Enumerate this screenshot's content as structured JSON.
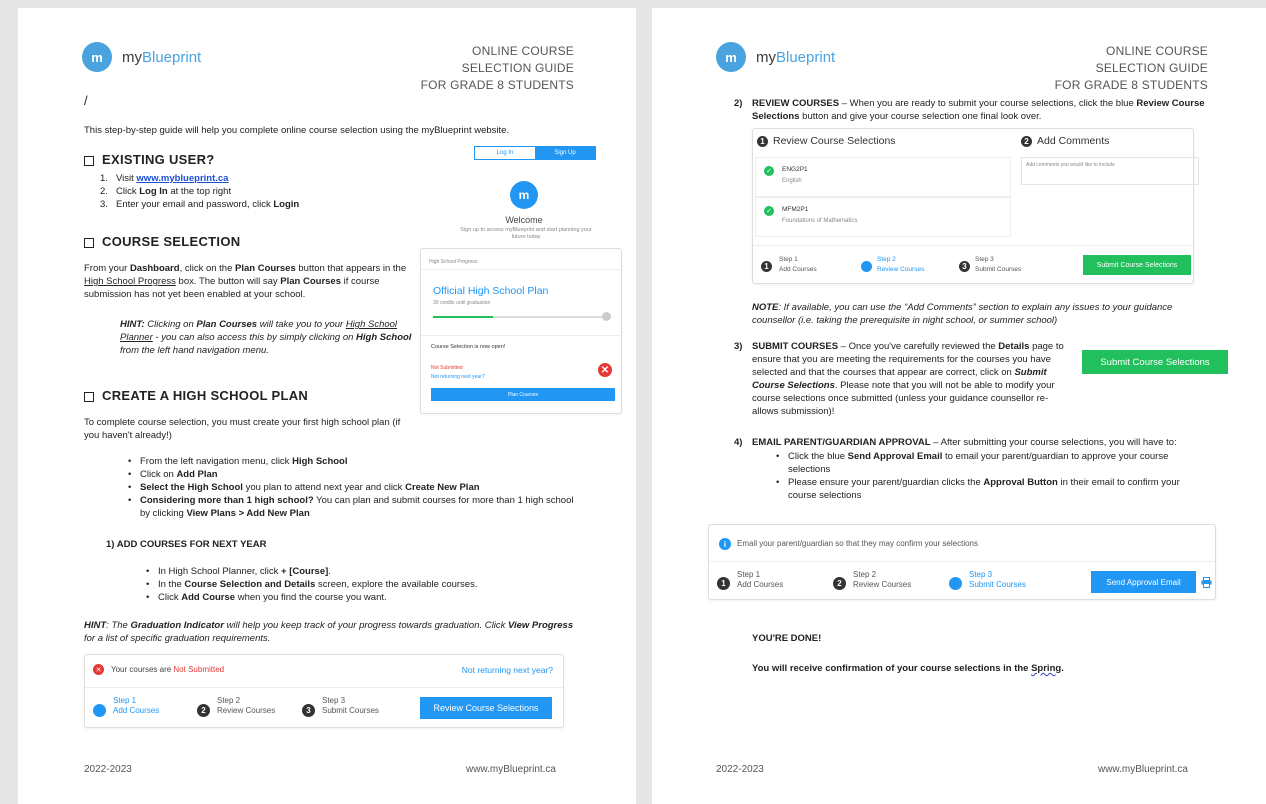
{
  "brand": {
    "logo_glyph": "m",
    "name_prefix": "my",
    "name_suffix": "Blueprint",
    "accent": "#4aa3df"
  },
  "guide_title": [
    "ONLINE COURSE",
    "SELECTION GUIDE",
    "FOR GRADE 8 STUDENTS"
  ],
  "page1": {
    "slash": "/",
    "intro": "This step-by-step guide will help you complete online course selection using the myBlueprint website.",
    "existing_user": {
      "heading": "EXISTING USER?",
      "items": [
        {
          "num": "1.",
          "pre": "Visit ",
          "bold": "www.myblueprint.ca",
          "post": ""
        },
        {
          "num": "2.",
          "pre": "Click ",
          "bold": "Log In",
          "post": " at the top right"
        },
        {
          "num": "3.",
          "pre": "Enter your email and password, click ",
          "bold": "Login",
          "post": ""
        }
      ]
    },
    "login_mock": {
      "tab_login": "Log In",
      "tab_signup": "Sign Up",
      "welcome": "Welcome",
      "subtext": "Sign up to access myBlueprint and start planning your future today"
    },
    "course_selection": {
      "heading": "COURSE SELECTION",
      "p1_a": "From your ",
      "p1_b": "Dashboard",
      "p1_c": ", click on the ",
      "p1_d": "Plan Courses",
      "p1_e": " button that appears in the ",
      "p1_f": "High School Progress",
      "p1_g": " box.  The button will say ",
      "p1_h": "Plan Courses",
      "p1_i": " if course submission has not yet been enabled at your school.",
      "hint_label": "HINT:",
      "hint_a": " Clicking on ",
      "hint_b": "Plan Courses",
      "hint_c": " will take you to your ",
      "hint_d": "High School Planner",
      "hint_e": " - you can also access this by simply clicking on ",
      "hint_f": "High School",
      "hint_g": " from the left hand navigation menu."
    },
    "progress_mock": {
      "label": "High School Progress",
      "plan_title": "Official High School Plan",
      "plan_sub": "30 credits until graduation",
      "open_msg": "Course Selection is now open!",
      "status": "Not Submitted",
      "not_returning": "Not returning next year?",
      "button": "Plan Courses"
    },
    "create_plan": {
      "heading": "CREATE A HIGH SCHOOL PLAN",
      "intro": "To complete course selection, you must create your first high school plan (if you haven't already!)",
      "bullets": [
        {
          "pre": "From the left navigation menu, click ",
          "bold": "High School",
          "post": ""
        },
        {
          "pre": "Click on ",
          "bold": "Add Plan",
          "post": ""
        },
        {
          "pre": "",
          "bold": "Select the High School",
          "post": " you plan to attend next year and click ",
          "bold2": "Create New Plan"
        },
        {
          "pre": "",
          "bold": "Considering more than 1 high school?",
          "post": " You can plan and submit courses for more than 1 high school by clicking ",
          "bold2": "View Plans > Add New Plan"
        }
      ]
    },
    "add_courses": {
      "heading": "1)   ADD COURSES FOR NEXT YEAR",
      "bullets": [
        {
          "pre": "In High School Planner, click ",
          "bold": "+ [Course]",
          "post": "."
        },
        {
          "pre": "In the ",
          "bold": "Course Selection and Details",
          "post": " screen, explore the available courses."
        },
        {
          "pre": "Click ",
          "bold": "Add Course",
          "post": " when you find the course you want."
        }
      ]
    },
    "hint2": {
      "label": "HINT",
      "a": ": The ",
      "b": "Graduation Indicator",
      "c": " will help you keep track of your progress towards graduation.  Click ",
      "d": "View Progress",
      "e": " for a list of specific graduation requirements."
    },
    "status_mock": {
      "status_pre": "Your courses are ",
      "status": "Not Submitted",
      "not_returning": "Not returning next year?",
      "steps": [
        {
          "n": "1",
          "title": "Step 1",
          "label": "Add Courses"
        },
        {
          "n": "2",
          "title": "Step 2",
          "label": "Review Courses"
        },
        {
          "n": "3",
          "title": "Step 3",
          "label": "Submit Courses"
        }
      ],
      "button": "Review Course Selections"
    },
    "footer_left": "2022-2023",
    "footer_right": "www.myBlueprint.ca"
  },
  "page2": {
    "review": {
      "num": "2)",
      "a": "REVIEW COURSES",
      "b": " – When you are ready to submit your course selections, click the blue ",
      "c": "Review Course Selections",
      "d": " button and give your course selection one final look over."
    },
    "review_mock": {
      "col1_num": "1",
      "col1_title": "Review Course Selections",
      "col2_num": "2",
      "col2_title": "Add Comments",
      "comment_placeholder": "Add comments you would like to include",
      "courses": [
        {
          "code": "ENG2P1",
          "name": "English"
        },
        {
          "code": "MFM2P1",
          "name": "Foundations of Mathematics"
        }
      ],
      "steps": [
        {
          "n": "1",
          "title": "Step 1",
          "label": "Add Courses"
        },
        {
          "n": "2",
          "title": "Step 2",
          "label": "Review Courses"
        },
        {
          "n": "3",
          "title": "Step 3",
          "label": "Submit Courses"
        }
      ],
      "button": "Submit Course Selections"
    },
    "note": {
      "label": "NOTE",
      "text": ": If available, you can use the “Add Comments” section to explain any issues to your guidance counsellor (i.e. taking the prerequisite in night school, or summer school)"
    },
    "submit": {
      "num": "3)",
      "a": "SUBMIT COURSES",
      "b": " – Once you've carefully reviewed the ",
      "c": "Details",
      "d": " page to ensure that you are meeting the requirements for the courses you have selected and that the courses that appear are correct, click on ",
      "e": "Submit Course Selections",
      "f": ". Please note that you will not be able to modify your course selections once submitted (unless your guidance counsellor re-allows submission)!"
    },
    "submit_button": "Submit Course Selections",
    "email": {
      "num": "4)",
      "a": "EMAIL PARENT/GUARDIAN APPROVAL",
      "b": " – After submitting your course selections, you will have to:",
      "bullets": [
        {
          "pre": "Click the blue ",
          "bold": "Send Approval Email",
          "post": " to email your parent/guardian to approve your course selections"
        },
        {
          "pre": "Please ensure your parent/guardian clicks the ",
          "bold": "Approval Button",
          "post": " in their email to confirm your course selections"
        }
      ]
    },
    "approval_mock": {
      "info": "Email your parent/guardian so that they may confirm your selections",
      "steps": [
        {
          "n": "1",
          "title": "Step 1",
          "label": "Add Courses"
        },
        {
          "n": "2",
          "title": "Step 2",
          "label": "Review Courses"
        },
        {
          "n": "3",
          "title": "Step 3",
          "label": "Submit Courses"
        }
      ],
      "button": "Send Approval Email"
    },
    "done": "YOU'RE DONE!",
    "confirm_pre": "You will receive confirmation of your course selections in the ",
    "confirm_season": "Spring",
    "confirm_post": ".",
    "footer_left": "2022-2023",
    "footer_right": "www.myBlueprint.ca"
  },
  "colors": {
    "blue": "#2196f3",
    "green": "#21c05c",
    "red": "#e53935",
    "dark": "#333333"
  }
}
